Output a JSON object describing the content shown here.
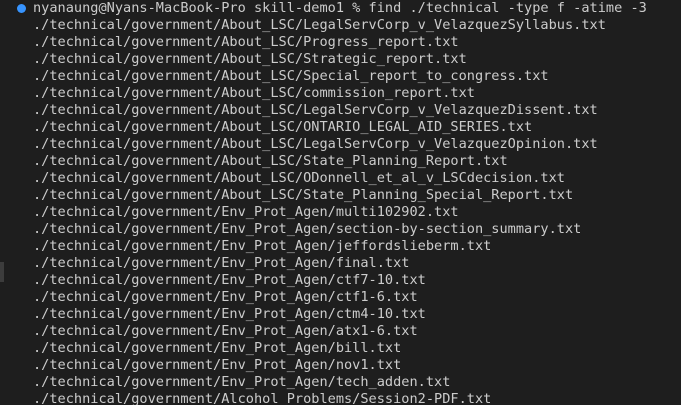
{
  "terminal": {
    "prompt": "nyanaung@Nyans-MacBook-Pro skill-demo1 % find ./technical -type f -atime -3",
    "prompt_marker_color": "#3794ff",
    "output": [
      "./technical/government/About_LSC/LegalServCorp_v_VelazquezSyllabus.txt",
      "./technical/government/About_LSC/Progress_report.txt",
      "./technical/government/About_LSC/Strategic_report.txt",
      "./technical/government/About_LSC/Special_report_to_congress.txt",
      "./technical/government/About_LSC/commission_report.txt",
      "./technical/government/About_LSC/LegalServCorp_v_VelazquezDissent.txt",
      "./technical/government/About_LSC/ONTARIO_LEGAL_AID_SERIES.txt",
      "./technical/government/About_LSC/LegalServCorp_v_VelazquezOpinion.txt",
      "./technical/government/About_LSC/State_Planning_Report.txt",
      "./technical/government/About_LSC/ODonnell_et_al_v_LSCdecision.txt",
      "./technical/government/About_LSC/State_Planning_Special_Report.txt",
      "./technical/government/Env_Prot_Agen/multi102902.txt",
      "./technical/government/Env_Prot_Agen/section-by-section_summary.txt",
      "./technical/government/Env_Prot_Agen/jeffordslieberm.txt",
      "./technical/government/Env_Prot_Agen/final.txt",
      "./technical/government/Env_Prot_Agen/ctf7-10.txt",
      "./technical/government/Env_Prot_Agen/ctf1-6.txt",
      "./technical/government/Env_Prot_Agen/ctm4-10.txt",
      "./technical/government/Env_Prot_Agen/atx1-6.txt",
      "./technical/government/Env_Prot_Agen/bill.txt",
      "./technical/government/Env_Prot_Agen/nov1.txt",
      "./technical/government/Env_Prot_Agen/tech_adden.txt",
      "./technical/government/Alcohol_Problems/Session2-PDF.txt"
    ]
  }
}
